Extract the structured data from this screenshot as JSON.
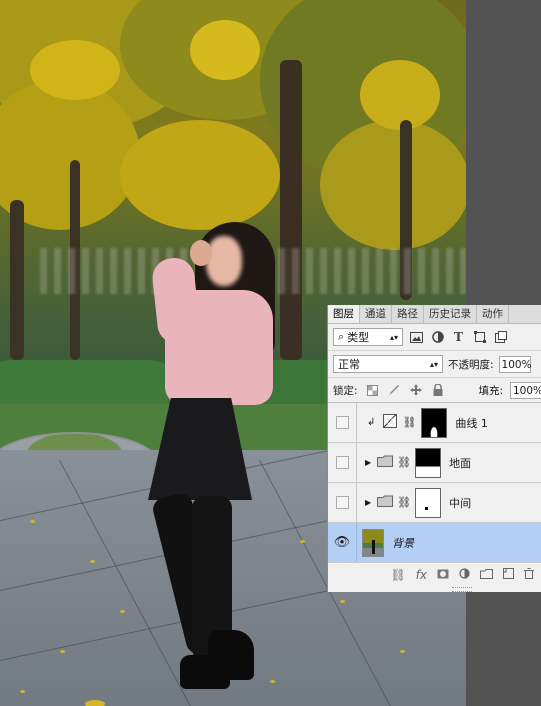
{
  "layers_panel": {
    "tabs": [
      "图层",
      "通道",
      "路径",
      "历史记录",
      "动作"
    ],
    "active_tab": "图层",
    "filter_kind": "类型",
    "blend_mode": "正常",
    "opacity_label": "不透明度:",
    "opacity_value": "100%",
    "lock_label": "锁定:",
    "fill_label": "填充:",
    "fill_value": "100%",
    "layers": [
      {
        "name": "曲线 1",
        "visible": false,
        "kind": "adjustment",
        "selected": false
      },
      {
        "name": "地面",
        "visible": false,
        "kind": "group",
        "selected": false
      },
      {
        "name": "中间",
        "visible": false,
        "kind": "group",
        "selected": false
      },
      {
        "name": "背景",
        "visible": true,
        "kind": "image",
        "selected": true
      }
    ],
    "filter_icons": [
      "image-filter-icon",
      "adjustment-filter-icon",
      "type-filter-icon",
      "shape-filter-icon",
      "smart-object-filter-icon"
    ],
    "lock_icons": [
      "lock-transparent-icon",
      "lock-paint-icon",
      "lock-position-icon",
      "lock-all-icon"
    ],
    "footer_icons": [
      "link-icon",
      "fx-icon",
      "mask-icon",
      "adjustment-icon",
      "folder-icon",
      "new-layer-icon",
      "trash-icon"
    ],
    "footer_fx": "fx",
    "type_glyph": "T",
    "eye_glyph": "👁"
  },
  "colors": {
    "selected_row": "#b4cff5",
    "panel_bg": "#f0f0f0",
    "workspace_bg": "#535353"
  }
}
